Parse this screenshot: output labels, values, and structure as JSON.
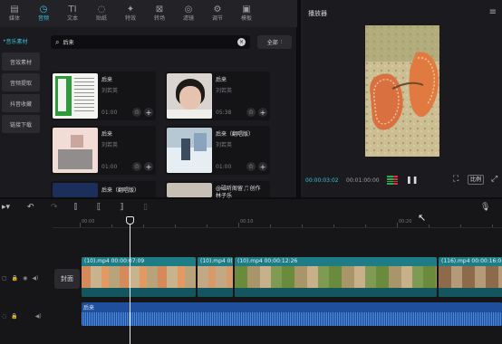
{
  "top_tabs": [
    {
      "label": "媒体",
      "icon": "media-icon"
    },
    {
      "label": "音频",
      "icon": "audio-icon",
      "active": true
    },
    {
      "label": "文本",
      "icon": "text-icon",
      "glyph": "TI"
    },
    {
      "label": "贴纸",
      "icon": "sticker-icon"
    },
    {
      "label": "特效",
      "icon": "effects-icon"
    },
    {
      "label": "转场",
      "icon": "transition-icon"
    },
    {
      "label": "滤镜",
      "icon": "filter-icon"
    },
    {
      "label": "调节",
      "icon": "adjust-icon"
    },
    {
      "label": "模板",
      "icon": "template-icon"
    }
  ],
  "side_categories": [
    "音乐素材",
    "音效素材",
    "音频提取",
    "抖音收藏",
    "链接下载"
  ],
  "search": {
    "value": "后来",
    "filter_label": "全部"
  },
  "results": [
    {
      "title": "后来",
      "artist": "刘若英",
      "duration": "01:00"
    },
    {
      "title": "后来",
      "artist": "刘若英",
      "duration": "05:38"
    },
    {
      "title": "后来",
      "artist": "刘若英",
      "duration": "01:00"
    },
    {
      "title": "后来（翻唱版）",
      "artist": "刘若英",
      "duration": "01:00"
    },
    {
      "title": "后来（翻唱版）",
      "artist": "",
      "duration": ""
    },
    {
      "title": "@磁听阁留🎵创作",
      "title2": "林子乐",
      "artist": "",
      "duration": ""
    }
  ],
  "player": {
    "title": "播放器",
    "current_time": "00:00:03:02",
    "total_time": "00:01:00:00",
    "ratio_label": "比例"
  },
  "timeline": {
    "ruler_labels": [
      "00:00",
      "00:10",
      "00:20"
    ],
    "cover_label": "封面",
    "clips": [
      {
        "label": "(10).mp4  00:00:07:09"
      },
      {
        "label": "(10).mp4  0("
      },
      {
        "label": "(10).mp4  00:00:12:26"
      },
      {
        "label": "(116).mp4  00:00:16:0"
      }
    ],
    "audio_label": "后来"
  },
  "colors": {
    "accent": "#39c0d8",
    "clip": "#1a6f78",
    "audio": "#1f4f9a"
  }
}
